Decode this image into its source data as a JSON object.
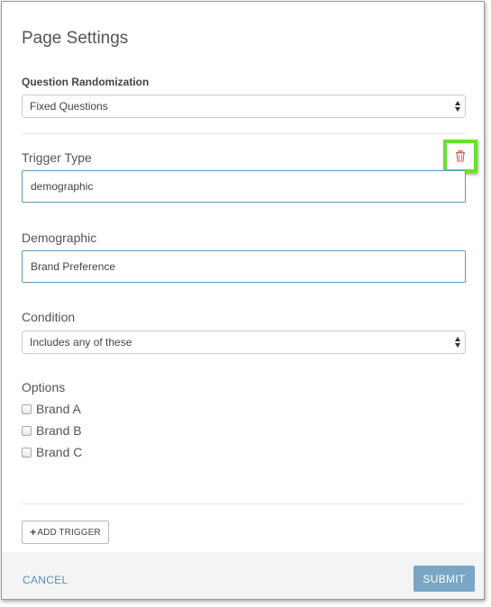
{
  "dialog": {
    "title": "Page Settings"
  },
  "randomization": {
    "label": "Question Randomization",
    "selected": "Fixed Questions"
  },
  "trigger": {
    "type_label": "Trigger Type",
    "type_value": "demographic",
    "delete_icon": "trash-icon",
    "delete_icon_color": "#e05a5a",
    "highlight_color": "#66e22a"
  },
  "demographic": {
    "label": "Demographic",
    "value": "Brand Preference"
  },
  "condition": {
    "label": "Condition",
    "selected": "Includes any of these"
  },
  "options": {
    "label": "Options",
    "items": [
      {
        "label": "Brand A",
        "checked": false
      },
      {
        "label": "Brand B",
        "checked": false
      },
      {
        "label": "Brand C",
        "checked": false
      }
    ]
  },
  "add_trigger": {
    "icon": "plus-icon",
    "label": "ADD TRIGGER"
  },
  "footer": {
    "cancel_label": "CANCEL",
    "submit_label": "SUBMIT",
    "link_color": "#5b8fb3",
    "submit_color": "#79a6c5"
  }
}
